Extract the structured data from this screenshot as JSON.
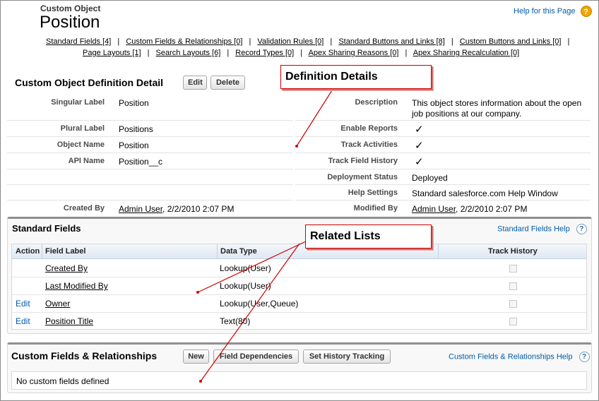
{
  "header": {
    "object_type": "Custom Object",
    "title": "Position",
    "help_link": "Help for this Page"
  },
  "related_nav": {
    "row1": [
      "Standard Fields [4]",
      "Custom Fields & Relationships [0]",
      "Validation Rules [0]",
      "Standard Buttons and Links [8]",
      "Custom Buttons and Links [0]"
    ],
    "row2": [
      "Page Layouts [1]",
      "Search Layouts [6]",
      "Record Types [0]",
      "Apex Sharing Reasons [0]",
      "Apex Sharing Recalculation [0]"
    ],
    "separator": "|"
  },
  "detail": {
    "heading": "Custom Object Definition Detail",
    "edit_label": "Edit",
    "delete_label": "Delete",
    "singular_label": {
      "label": "Singular Label",
      "value": "Position"
    },
    "plural_label": {
      "label": "Plural Label",
      "value": "Positions"
    },
    "object_name": {
      "label": "Object Name",
      "value": "Position"
    },
    "api_name": {
      "label": "API Name",
      "value": "Position__c"
    },
    "created_by": {
      "label": "Created By",
      "user": "Admin User",
      "date": ", 2/2/2010 2:07 PM"
    },
    "description": {
      "label": "Description",
      "line1": "This object stores information about the open",
      "line2": "job positions at our company."
    },
    "enable_reports": {
      "label": "Enable Reports",
      "checked": "✓"
    },
    "track_activities": {
      "label": "Track Activities",
      "checked": "✓"
    },
    "track_field_history": {
      "label": "Track Field History",
      "checked": "✓"
    },
    "deployment_status": {
      "label": "Deployment Status",
      "value": "Deployed"
    },
    "help_settings": {
      "label": "Help Settings",
      "value": "Standard salesforce.com Help Window"
    },
    "modified_by": {
      "label": "Modified By",
      "user": "Admin User",
      "date": ", 2/2/2010 2:07 PM"
    }
  },
  "callouts": {
    "definition": "Definition Details",
    "related": "Related Lists"
  },
  "standard_fields": {
    "heading": "Standard Fields",
    "help": "Standard Fields Help",
    "columns": [
      "Action",
      "Field Label",
      "Data Type",
      "Track History"
    ],
    "rows": [
      {
        "action": "",
        "label": "Created By",
        "type": "Lookup(User)"
      },
      {
        "action": "",
        "label": "Last Modified By",
        "type": "Lookup(User)"
      },
      {
        "action": "Edit",
        "label": "Owner",
        "type": "Lookup(User,Queue)"
      },
      {
        "action": "Edit",
        "label": "Position Title",
        "type": "Text(80)"
      }
    ]
  },
  "custom_fields": {
    "heading": "Custom Fields & Relationships",
    "new_label": "New",
    "dependencies_label": "Field Dependencies",
    "history_label": "Set History Tracking",
    "help": "Custom Fields & Relationships Help",
    "empty": "No custom fields defined"
  },
  "icons": {
    "help": "?",
    "colors": {
      "link_blue": "#015ba7",
      "callout_red": "#cc0000",
      "help_orange": "#f0a500"
    }
  }
}
